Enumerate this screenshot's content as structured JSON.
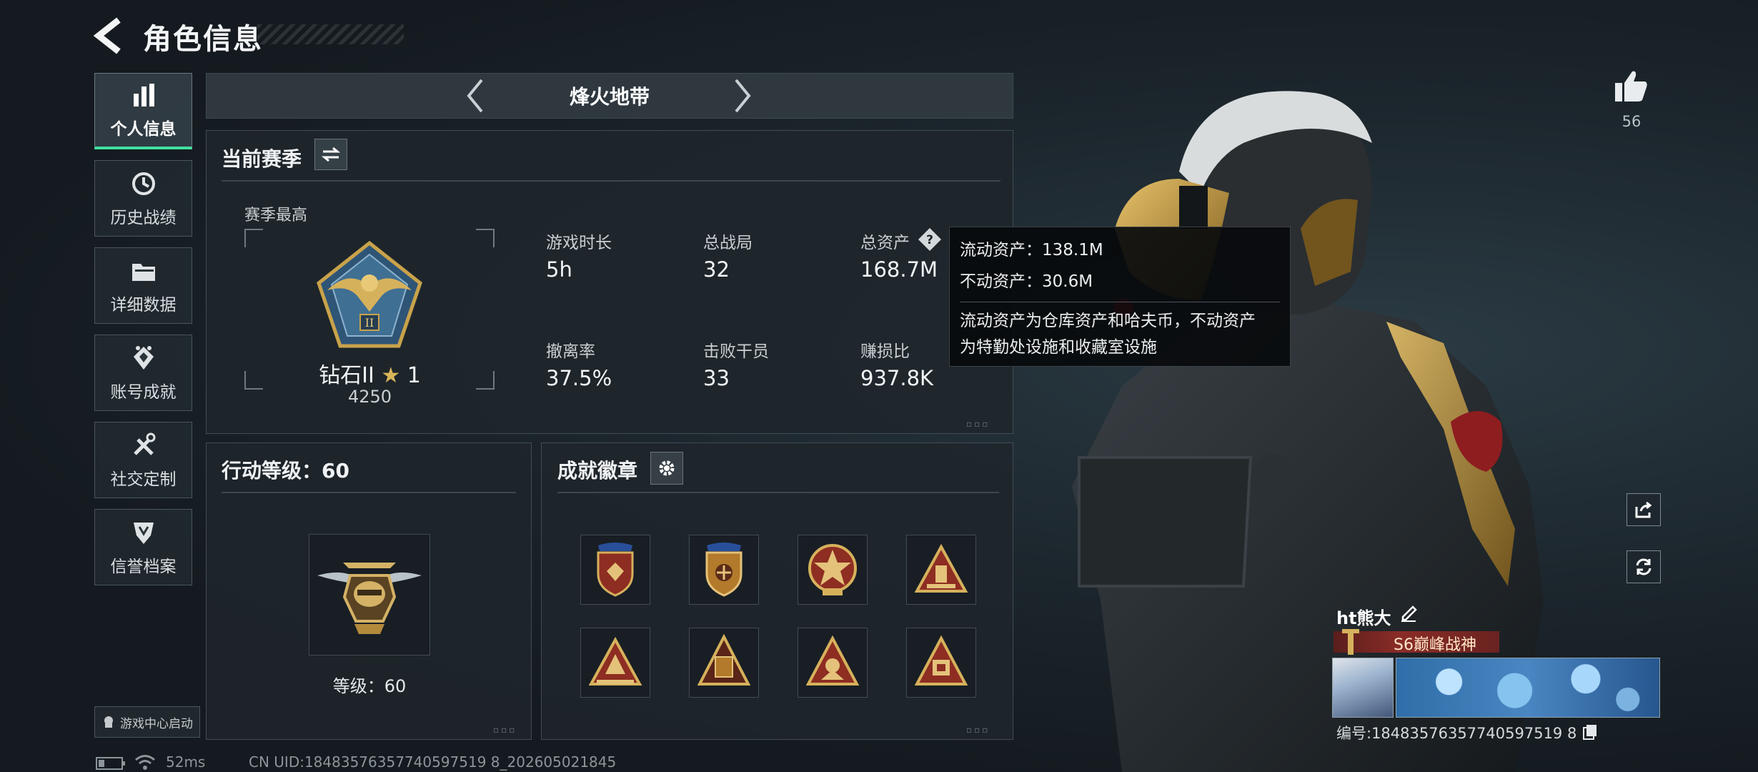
{
  "header": {
    "title": "角色信息"
  },
  "nav": {
    "items": [
      {
        "label": "个人信息",
        "icon": "bar-chart-icon",
        "active": true
      },
      {
        "label": "历史战绩",
        "icon": "history-icon",
        "active": false
      },
      {
        "label": "详细数据",
        "icon": "folder-icon",
        "active": false
      },
      {
        "label": "账号成就",
        "icon": "achievement-icon",
        "active": false
      },
      {
        "label": "社交定制",
        "icon": "tools-icon",
        "active": false
      },
      {
        "label": "信誉档案",
        "icon": "shield-icon",
        "active": false
      }
    ],
    "game_center_label": "游戏中心启动"
  },
  "mode": {
    "name": "烽火地带"
  },
  "season": {
    "title": "当前赛季",
    "best_label": "赛季最高",
    "rank": {
      "name": "钻石II",
      "stars": "1",
      "score": "4250"
    },
    "stats": [
      {
        "label": "游戏时长",
        "value": "5h"
      },
      {
        "label": "总战局",
        "value": "32"
      },
      {
        "label": "总资产",
        "value": "168.7M"
      },
      {
        "label": "撤离率",
        "value": "37.5%"
      },
      {
        "label": "击败干员",
        "value": "33"
      },
      {
        "label": "赚损比",
        "value": "937.8K"
      }
    ]
  },
  "tooltip": {
    "liquid": "流动资产：138.1M",
    "fixed": "不动资产：30.6M",
    "desc_line1": "流动资产为仓库资产和哈夫币，不动资产",
    "desc_line2": "为特勤处设施和收藏室设施"
  },
  "action_level": {
    "title": "行动等级：60",
    "level_text": "等级：60"
  },
  "achievements": {
    "title": "成就徽章",
    "badges": [
      "shield-badge-red",
      "shield-badge-gold",
      "star-medal-badge",
      "triangle-badge-a",
      "triangle-badge-b",
      "triangle-badge-c",
      "triangle-badge-d",
      "triangle-badge-e"
    ]
  },
  "status_bar": {
    "ping": "52ms",
    "uid": "CN UID:18483576357740597519 8_202605021845"
  },
  "profile": {
    "likes": "56",
    "name": "ht熊大",
    "title": "S6巅峰战神",
    "id_label": "编号:18483576357740597519 8"
  },
  "colors": {
    "accent": "#3fe0a0",
    "title_badge": "#8a2c28",
    "gold": "#c9a24a"
  }
}
